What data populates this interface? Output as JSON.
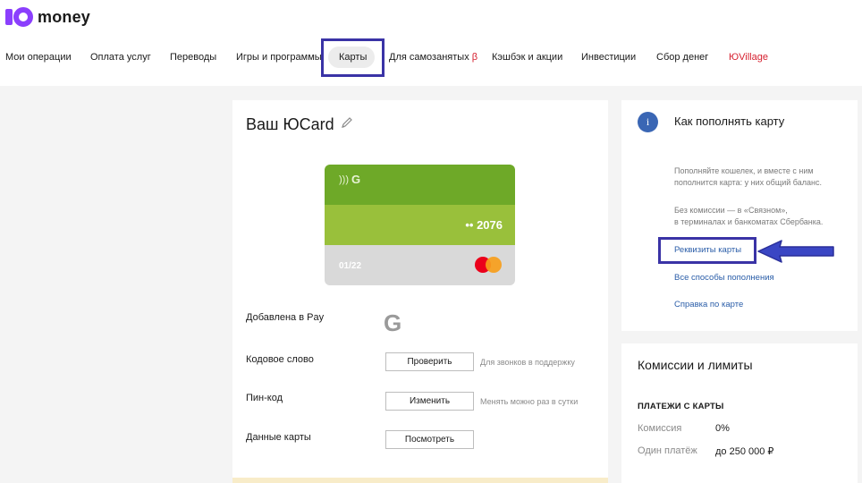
{
  "brand": {
    "name": "money"
  },
  "nav": {
    "items": [
      {
        "label": "Мои операции"
      },
      {
        "label": "Оплата услуг"
      },
      {
        "label": "Переводы"
      },
      {
        "label": "Игры и программы"
      },
      {
        "label": "Карты"
      },
      {
        "label": "Для самозанятых",
        "badge": "β"
      },
      {
        "label": "Кэшбэк и акции"
      },
      {
        "label": "Инвестиции"
      },
      {
        "label": "Сбор денег"
      },
      {
        "label": "ЮVillage"
      }
    ],
    "active": "Карты"
  },
  "card_panel": {
    "title": "Ваш ЮCard",
    "card": {
      "brand_letter": "G",
      "number_masked": "•• 2076",
      "expiry": "01/22"
    },
    "rows": {
      "added_label": "Добавлена в Pay",
      "codeword_label": "Кодовое слово",
      "codeword_button": "Проверить",
      "codeword_hint": "Для звонков в поддержку",
      "pin_label": "Пин-код",
      "pin_button": "Изменить",
      "pin_hint": "Менять можно раз в сутки",
      "data_label": "Данные карты",
      "data_button": "Посмотреть"
    }
  },
  "topup_panel": {
    "title": "Как пополнять карту",
    "text1_line1": "Пополняйте кошелек, и вместе с ним",
    "text1_line2": "пополнится карта: у них общий баланс.",
    "text2_line1": "Без комиссии — в «Связном»,",
    "text2_line2": "в терминалах и банкоматах Сбербанка.",
    "link_requisites": "Реквизиты карты",
    "link_all_methods": "Все способы пополнения",
    "link_help": "Справка по карте"
  },
  "limits_panel": {
    "title": "Комиссии и лимиты",
    "subtitle": "ПЛАТЕЖИ С КАРТЫ",
    "commission_label": "Комиссия",
    "commission_value": "0%",
    "single_payment_label": "Один платёж",
    "single_payment_value": "до 250 000 ₽"
  },
  "colors": {
    "brand_purple": "#8b3ffd",
    "card_green_dark": "#6ea928",
    "card_green_light": "#99c03b",
    "card_grey": "#d9d9d9",
    "link_blue": "#2a5da8",
    "annotation_blue": "#3a33a6"
  }
}
